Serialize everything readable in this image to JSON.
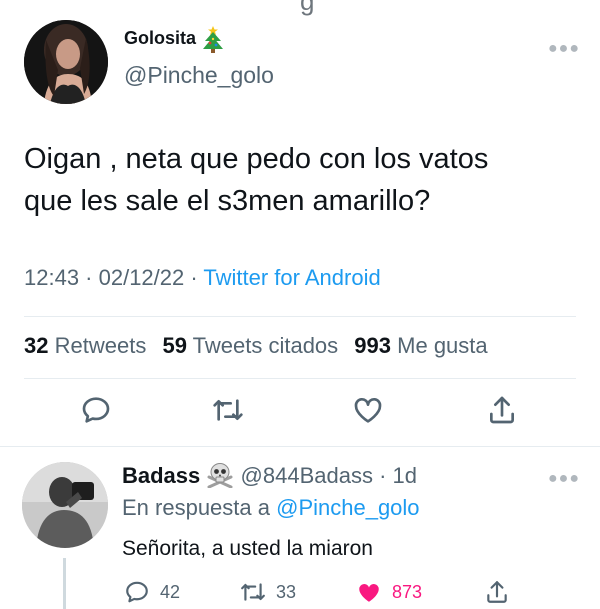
{
  "tweet": {
    "display_name": "Golosita",
    "display_name_emoji": "christmas-tree",
    "handle": "@Pinche_golo",
    "text_line1": "Oigan , neta que pedo con los vatos",
    "text_line2": "que les sale el s3men amarillo?",
    "time": "12:43 · 02/12/22 · ",
    "source": "Twitter for Android",
    "stats": {
      "retweets_count": "32",
      "retweets_label": "Retweets",
      "quotes_count": "59",
      "quotes_label": "Tweets citados",
      "likes_count": "993",
      "likes_label": "Me gusta"
    },
    "actions": [
      "reply-icon",
      "retweet-icon",
      "like-icon",
      "share-icon"
    ]
  },
  "reply": {
    "display_name": "Badass",
    "display_name_emoji": "skull-crossbones",
    "handle_time": "@844Badass · 1d",
    "in_reply_prefix": "En respuesta a ",
    "in_reply_handle": "@Pinche_golo",
    "text": "Señorita, a usted la miaron",
    "reply_count": "42",
    "retweet_count": "33",
    "like_count": "873"
  },
  "colors": {
    "link": "#1d9bf0",
    "secondary_text": "#536471",
    "like": "#f91880",
    "divider": "#e6ecf0"
  }
}
